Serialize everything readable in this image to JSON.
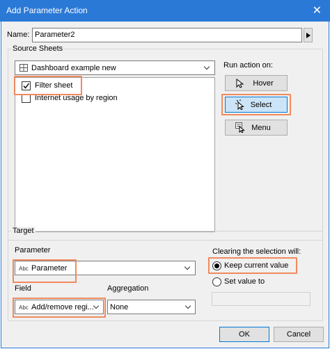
{
  "window": {
    "title": "Add Parameter Action",
    "close_glyph": "✕"
  },
  "name_field": {
    "label": "Name:",
    "value": "Parameter2"
  },
  "source_sheets": {
    "legend": "Source Sheets",
    "dashboard_select": "Dashboard example new",
    "sheets": [
      {
        "label": "Filter sheet",
        "checked": true
      },
      {
        "label": "Internet usage by region",
        "checked": false
      }
    ]
  },
  "run_action": {
    "label": "Run action on:",
    "buttons": [
      {
        "label": "Hover",
        "icon": "pointer-icon"
      },
      {
        "label": "Select",
        "icon": "select-pointer-icon",
        "selected": true
      },
      {
        "label": "Menu",
        "icon": "menu-icon"
      }
    ]
  },
  "target": {
    "legend": "Target",
    "parameter_label": "Parameter",
    "parameter_value": "Parameter",
    "field_label": "Field",
    "field_value": "Add/remove regi...",
    "aggregation_label": "Aggregation",
    "aggregation_value": "None",
    "type_badge": "Abc"
  },
  "clearing": {
    "label": "Clearing the selection will:",
    "options": [
      {
        "label": "Keep current value",
        "selected": true
      },
      {
        "label": "Set value to",
        "selected": false
      }
    ]
  },
  "footer": {
    "ok": "OK",
    "cancel": "Cancel"
  },
  "colors": {
    "title_bar": "#2b79d6",
    "highlight": "#f08a5d",
    "selected_button": "#cce4f7"
  }
}
